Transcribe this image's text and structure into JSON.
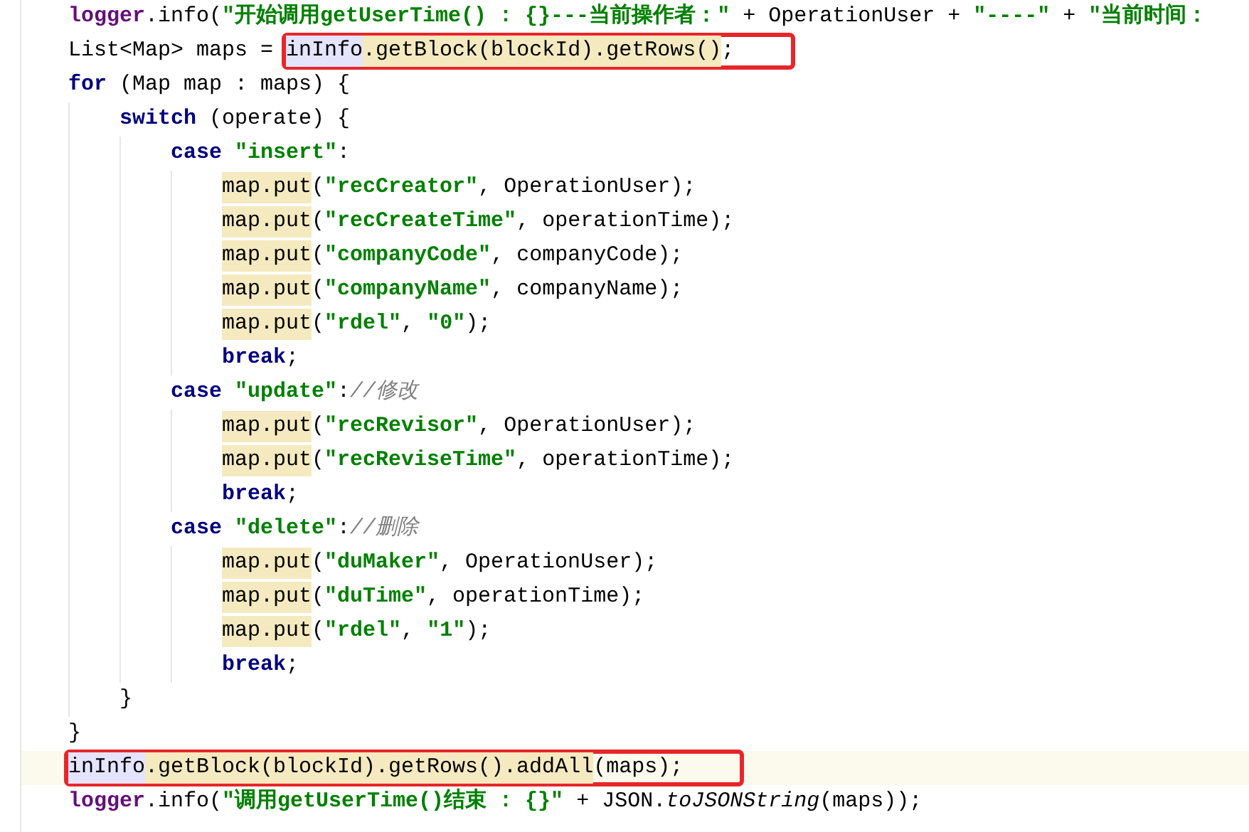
{
  "editor": {
    "lines": [
      {
        "current": false,
        "segments": [
          {
            "boxed": false,
            "tokens": [
              {
                "kind": "field",
                "text": "logger"
              },
              {
                "kind": "plain",
                "text": ".info("
              },
              {
                "kind": "str",
                "text": "\"开始调用getUserTime() : {}---当前操作者：\""
              },
              {
                "kind": "plain",
                "text": " + OperationUser + "
              },
              {
                "kind": "str",
                "text": "\"----\""
              },
              {
                "kind": "plain",
                "text": " + "
              },
              {
                "kind": "str",
                "text": "\"当前时间："
              }
            ]
          }
        ]
      },
      {
        "current": false,
        "segments": [
          {
            "boxed": false,
            "tokens": [
              {
                "kind": "plain",
                "text": "List<Map> maps = "
              }
            ]
          },
          {
            "boxed": true,
            "tokens": [
              {
                "kind": "var",
                "text": "inInfo"
              },
              {
                "kind": "call",
                "text": ".getBlock(blockId).getRows()"
              },
              {
                "kind": "plain",
                "text": ";"
              }
            ]
          }
        ]
      },
      {
        "current": false,
        "segments": [
          {
            "boxed": false,
            "tokens": [
              {
                "kind": "kw",
                "text": "for"
              },
              {
                "kind": "plain",
                "text": " (Map map : maps) {"
              }
            ]
          }
        ],
        "children": [
          {
            "current": false,
            "segments": [
              {
                "boxed": false,
                "tokens": [
                  {
                    "kind": "kw",
                    "text": "switch"
                  },
                  {
                    "kind": "plain",
                    "text": " (operate) {"
                  }
                ]
              }
            ],
            "children": [
              {
                "current": false,
                "segments": [
                  {
                    "boxed": false,
                    "tokens": [
                      {
                        "kind": "kw",
                        "text": "case"
                      },
                      {
                        "kind": "str",
                        "text": " \"insert\""
                      },
                      {
                        "kind": "plain",
                        "text": ":"
                      }
                    ]
                  }
                ],
                "children": [
                  {
                    "current": false,
                    "segments": [
                      {
                        "boxed": false,
                        "tokens": [
                          {
                            "kind": "call",
                            "text": "map.put"
                          },
                          {
                            "kind": "plain",
                            "text": "("
                          },
                          {
                            "kind": "str",
                            "text": "\"recCreator\""
                          },
                          {
                            "kind": "plain",
                            "text": ", OperationUser);"
                          }
                        ]
                      }
                    ]
                  },
                  {
                    "current": false,
                    "segments": [
                      {
                        "boxed": false,
                        "tokens": [
                          {
                            "kind": "call",
                            "text": "map.put"
                          },
                          {
                            "kind": "plain",
                            "text": "("
                          },
                          {
                            "kind": "str",
                            "text": "\"recCreateTime\""
                          },
                          {
                            "kind": "plain",
                            "text": ", operationTime);"
                          }
                        ]
                      }
                    ]
                  },
                  {
                    "current": false,
                    "segments": [
                      {
                        "boxed": false,
                        "tokens": [
                          {
                            "kind": "call",
                            "text": "map.put"
                          },
                          {
                            "kind": "plain",
                            "text": "("
                          },
                          {
                            "kind": "str",
                            "text": "\"companyCode\""
                          },
                          {
                            "kind": "plain",
                            "text": ", companyCode);"
                          }
                        ]
                      }
                    ]
                  },
                  {
                    "current": false,
                    "segments": [
                      {
                        "boxed": false,
                        "tokens": [
                          {
                            "kind": "call",
                            "text": "map.put"
                          },
                          {
                            "kind": "plain",
                            "text": "("
                          },
                          {
                            "kind": "str",
                            "text": "\"companyName\""
                          },
                          {
                            "kind": "plain",
                            "text": ", companyName);"
                          }
                        ]
                      }
                    ]
                  },
                  {
                    "current": false,
                    "segments": [
                      {
                        "boxed": false,
                        "tokens": [
                          {
                            "kind": "call",
                            "text": "map.put"
                          },
                          {
                            "kind": "plain",
                            "text": "("
                          },
                          {
                            "kind": "str",
                            "text": "\"rdel\""
                          },
                          {
                            "kind": "plain",
                            "text": ", "
                          },
                          {
                            "kind": "str",
                            "text": "\"0\""
                          },
                          {
                            "kind": "plain",
                            "text": ");"
                          }
                        ]
                      }
                    ]
                  },
                  {
                    "current": false,
                    "segments": [
                      {
                        "boxed": false,
                        "tokens": [
                          {
                            "kind": "kw",
                            "text": "break"
                          },
                          {
                            "kind": "plain",
                            "text": ";"
                          }
                        ]
                      }
                    ]
                  }
                ]
              },
              {
                "current": false,
                "segments": [
                  {
                    "boxed": false,
                    "tokens": [
                      {
                        "kind": "kw",
                        "text": "case"
                      },
                      {
                        "kind": "str",
                        "text": " \"update\""
                      },
                      {
                        "kind": "plain",
                        "text": ":"
                      },
                      {
                        "kind": "comment",
                        "text": "//修改"
                      }
                    ]
                  }
                ],
                "children": [
                  {
                    "current": false,
                    "segments": [
                      {
                        "boxed": false,
                        "tokens": [
                          {
                            "kind": "call",
                            "text": "map.put"
                          },
                          {
                            "kind": "plain",
                            "text": "("
                          },
                          {
                            "kind": "str",
                            "text": "\"recRevisor\""
                          },
                          {
                            "kind": "plain",
                            "text": ", OperationUser);"
                          }
                        ]
                      }
                    ]
                  },
                  {
                    "current": false,
                    "segments": [
                      {
                        "boxed": false,
                        "tokens": [
                          {
                            "kind": "call",
                            "text": "map.put"
                          },
                          {
                            "kind": "plain",
                            "text": "("
                          },
                          {
                            "kind": "str",
                            "text": "\"recReviseTime\""
                          },
                          {
                            "kind": "plain",
                            "text": ", operationTime);"
                          }
                        ]
                      }
                    ]
                  },
                  {
                    "current": false,
                    "segments": [
                      {
                        "boxed": false,
                        "tokens": [
                          {
                            "kind": "kw",
                            "text": "break"
                          },
                          {
                            "kind": "plain",
                            "text": ";"
                          }
                        ]
                      }
                    ]
                  }
                ]
              },
              {
                "current": false,
                "segments": [
                  {
                    "boxed": false,
                    "tokens": [
                      {
                        "kind": "kw",
                        "text": "case"
                      },
                      {
                        "kind": "str",
                        "text": " \"delete\""
                      },
                      {
                        "kind": "plain",
                        "text": ":"
                      },
                      {
                        "kind": "comment",
                        "text": "//删除"
                      }
                    ]
                  }
                ],
                "children": [
                  {
                    "current": false,
                    "segments": [
                      {
                        "boxed": false,
                        "tokens": [
                          {
                            "kind": "call",
                            "text": "map.put"
                          },
                          {
                            "kind": "plain",
                            "text": "("
                          },
                          {
                            "kind": "str",
                            "text": "\"duMaker\""
                          },
                          {
                            "kind": "plain",
                            "text": ", OperationUser);"
                          }
                        ]
                      }
                    ]
                  },
                  {
                    "current": false,
                    "segments": [
                      {
                        "boxed": false,
                        "tokens": [
                          {
                            "kind": "call",
                            "text": "map.put"
                          },
                          {
                            "kind": "plain",
                            "text": "("
                          },
                          {
                            "kind": "str",
                            "text": "\"duTime\""
                          },
                          {
                            "kind": "plain",
                            "text": ", operationTime);"
                          }
                        ]
                      }
                    ]
                  },
                  {
                    "current": false,
                    "segments": [
                      {
                        "boxed": false,
                        "tokens": [
                          {
                            "kind": "call",
                            "text": "map.put"
                          },
                          {
                            "kind": "plain",
                            "text": "("
                          },
                          {
                            "kind": "str",
                            "text": "\"rdel\""
                          },
                          {
                            "kind": "plain",
                            "text": ", "
                          },
                          {
                            "kind": "str",
                            "text": "\"1\""
                          },
                          {
                            "kind": "plain",
                            "text": ");"
                          }
                        ]
                      }
                    ]
                  },
                  {
                    "current": false,
                    "segments": [
                      {
                        "boxed": false,
                        "tokens": [
                          {
                            "kind": "kw",
                            "text": "break"
                          },
                          {
                            "kind": "plain",
                            "text": ";"
                          }
                        ]
                      }
                    ]
                  }
                ]
              }
            ]
          },
          {
            "current": false,
            "segments": [
              {
                "boxed": false,
                "tokens": [
                  {
                    "kind": "plain",
                    "text": "}"
                  }
                ]
              }
            ]
          }
        ]
      },
      {
        "current": false,
        "segments": [
          {
            "boxed": false,
            "tokens": [
              {
                "kind": "plain",
                "text": "}"
              }
            ]
          }
        ]
      },
      {
        "current": true,
        "segments": [
          {
            "boxed": true,
            "tokens": [
              {
                "kind": "var",
                "text": "inInfo"
              },
              {
                "kind": "call",
                "text": ".getBlock(blockId).getRows().addAll"
              },
              {
                "kind": "plain",
                "text": "(maps);"
              }
            ]
          }
        ]
      },
      {
        "current": false,
        "segments": [
          {
            "boxed": false,
            "tokens": [
              {
                "kind": "field",
                "text": "logger"
              },
              {
                "kind": "plain",
                "text": ".info("
              },
              {
                "kind": "str",
                "text": "\"调用getUserTime()结束 : {}\""
              },
              {
                "kind": "plain",
                "text": " + JSON."
              },
              {
                "kind": "italic",
                "text": "toJSONString"
              },
              {
                "kind": "plain",
                "text": "(maps));"
              }
            ]
          }
        ]
      }
    ]
  }
}
